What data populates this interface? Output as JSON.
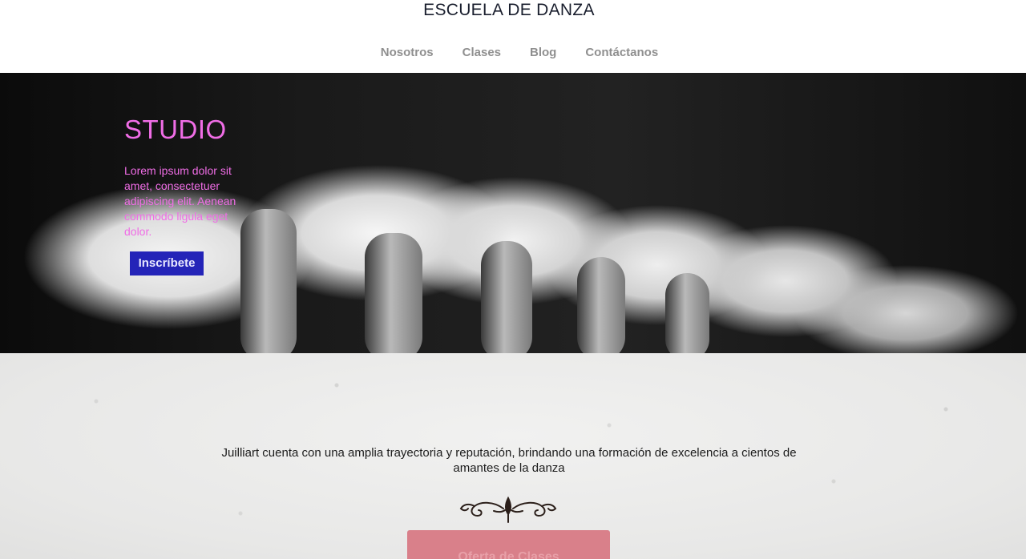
{
  "header": {
    "title": "ESCUELA DE DANZA",
    "nav": [
      {
        "label": "Nosotros"
      },
      {
        "label": "Clases"
      },
      {
        "label": "Blog"
      },
      {
        "label": "Contáctanos"
      }
    ]
  },
  "hero": {
    "title": "STUDIO",
    "text": "Lorem ipsum dolor sit amet, consectetuer adipiscing elit. Aenean commodo ligula eget dolor.",
    "cta_label": "Inscríbete",
    "colors": {
      "title": "#f06de6",
      "cta_bg": "#2424b8"
    }
  },
  "main": {
    "intro": "Juilliart cuenta con una amplia trayectoria y reputación, brindando una formación de excelencia a cientos de amantes de la danza",
    "ornament_icon": "flourish-divider-icon",
    "offer_button_label": "Oferta de Clases",
    "colors": {
      "offer_bg": "#d9808a"
    }
  }
}
